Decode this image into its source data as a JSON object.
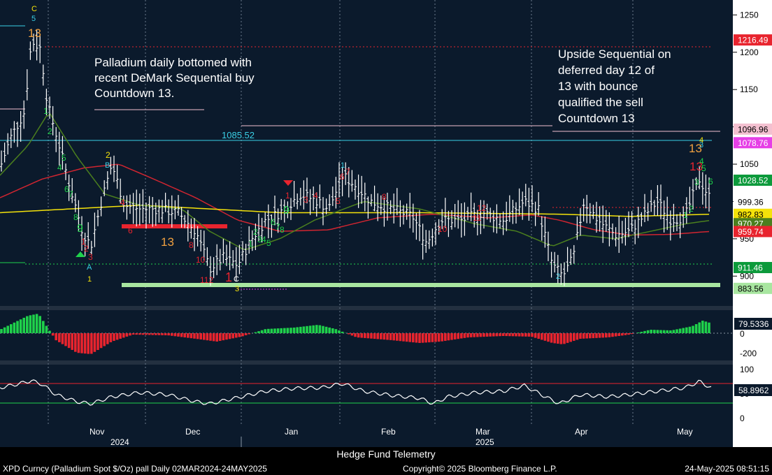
{
  "chart_data": {
    "type": "candlestick",
    "instrument": "XPD Curncy (Palladium Spot $/Oz) pall",
    "period": "Daily 02MAR2024-24MAY2025",
    "months": [
      "Nov",
      "Dec",
      "Jan",
      "Feb",
      "Mar",
      "Apr",
      "May"
    ],
    "years": [
      "2024",
      "2025"
    ],
    "y_ticks": [
      900,
      950,
      1000,
      1050,
      1100,
      1150,
      1200,
      1250
    ],
    "ylim": [
      860,
      1270
    ],
    "price_labels": [
      {
        "text": "1216.49",
        "value": 1216.49,
        "color": "#e8242e"
      },
      {
        "text": "1096.96",
        "value": 1096.96,
        "color": "#f3c0d0"
      },
      {
        "text": "1078.76",
        "value": 1078.76,
        "color": "#e63fe6"
      },
      {
        "text": "1028.52",
        "value": 1028.52,
        "color": "#0c9a3b"
      },
      {
        "text": "999.36",
        "value": 999.36,
        "color": "#ffffff"
      },
      {
        "text": "982.83",
        "value": 982.83,
        "color": "#f4e20a"
      },
      {
        "text": "970.27",
        "value": 970.27,
        "color": "#4b7f1e"
      },
      {
        "text": "959.74",
        "value": 959.74,
        "color": "#e8242e"
      },
      {
        "text": "911.46",
        "value": 911.46,
        "color": "#0c9a3b"
      },
      {
        "text": "883.56",
        "value": 883.56,
        "color": "#a8e6a0"
      }
    ],
    "level_label": "1085.52",
    "annotations": [
      "Palladium daily bottomed with",
      "recent DeMark Sequential buy",
      "Countdown 13.",
      "Upside Sequential on",
      "deferred day 12 of",
      "13 with bounce",
      "qualified the sell",
      "Countdown 13"
    ],
    "osc1_ticks": [
      0,
      -200
    ],
    "osc1_label": "79.5336",
    "osc2_ticks": [
      100,
      50,
      0
    ],
    "osc2_label": "58.8962"
  },
  "footer": {
    "title": "Hedge Fund Telemetry",
    "left": "XPD Curncy (Palladium Spot  $/Oz) pall  Daily 02MAR2024-24MAY2025",
    "center": "Copyright© 2025 Bloomberg Finance L.P.",
    "right": "24-May-2025 08:51:15"
  },
  "colors": {
    "bg": "#0b1a2c",
    "up": "#ffffff",
    "red": "#e8242e",
    "green": "#1fd14b",
    "yellow": "#f4e20a",
    "cyan": "#3ad0e6"
  }
}
